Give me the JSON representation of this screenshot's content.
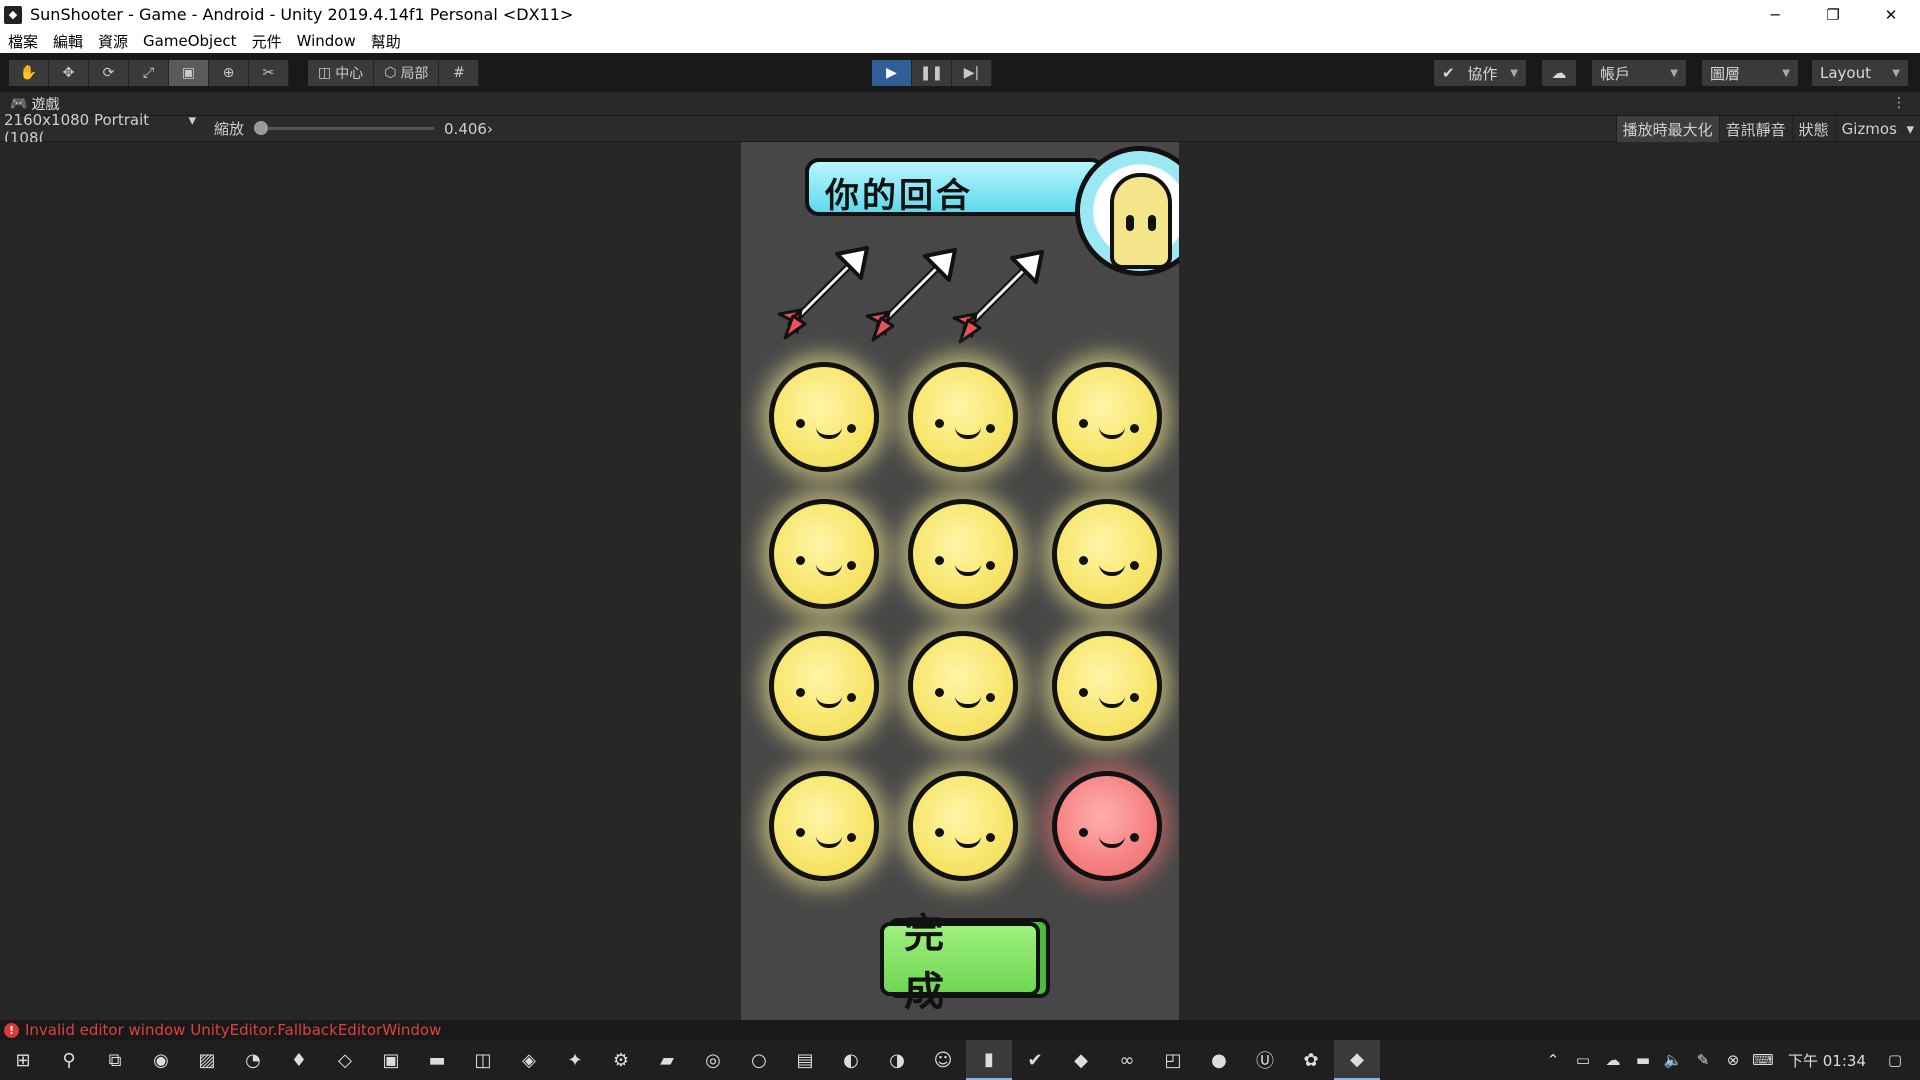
{
  "window": {
    "title": "SunShooter - Game - Android - Unity 2019.4.14f1 Personal <DX11>",
    "controls": [
      "─",
      "❐",
      "✕"
    ]
  },
  "menu": [
    "檔案",
    "編輯",
    "資源",
    "GameObject",
    "元件",
    "Window",
    "幫助"
  ],
  "toolbar": {
    "tools": [
      "hand-icon",
      "move-icon",
      "rotate-icon",
      "scale-icon",
      "rect-icon",
      "transform-icon",
      "custom-tool-icon"
    ],
    "pivot_label": "中心",
    "space_label": "局部",
    "collab_label": "協作",
    "account_label": "帳戶",
    "layers_label": "圖層",
    "layout_label": "Layout"
  },
  "game_tab": {
    "label": "遊戲",
    "resolution": "2160x1080 Portrait (108(",
    "scale_label": "縮放",
    "scale_value": "0.406",
    "scale_fraction": 0.0,
    "toggles": [
      "播放時最大化",
      "音訊靜音",
      "狀態",
      "Gizmos"
    ]
  },
  "game": {
    "turn_text": "你的回合",
    "arrows_remaining": 3,
    "suns": [
      {
        "color": "yellow"
      },
      {
        "color": "yellow"
      },
      {
        "color": "yellow"
      },
      {
        "color": "yellow"
      },
      {
        "color": "yellow"
      },
      {
        "color": "yellow"
      },
      {
        "color": "yellow"
      },
      {
        "color": "yellow"
      },
      {
        "color": "yellow"
      },
      {
        "color": "yellow"
      },
      {
        "color": "yellow"
      },
      {
        "color": "red"
      }
    ],
    "done_label": "完成"
  },
  "status": {
    "message": "Invalid editor window UnityEditor.FallbackEditorWindow"
  },
  "taskbar": {
    "clock": "下午 01:34"
  },
  "colors": {
    "accent_play": "#2f5f96",
    "error": "#e04040",
    "sun_yellow": "#f7e56a",
    "sun_red": "#f68080",
    "banner_cyan": "#5fd9ec",
    "done_green": "#6fd653"
  }
}
